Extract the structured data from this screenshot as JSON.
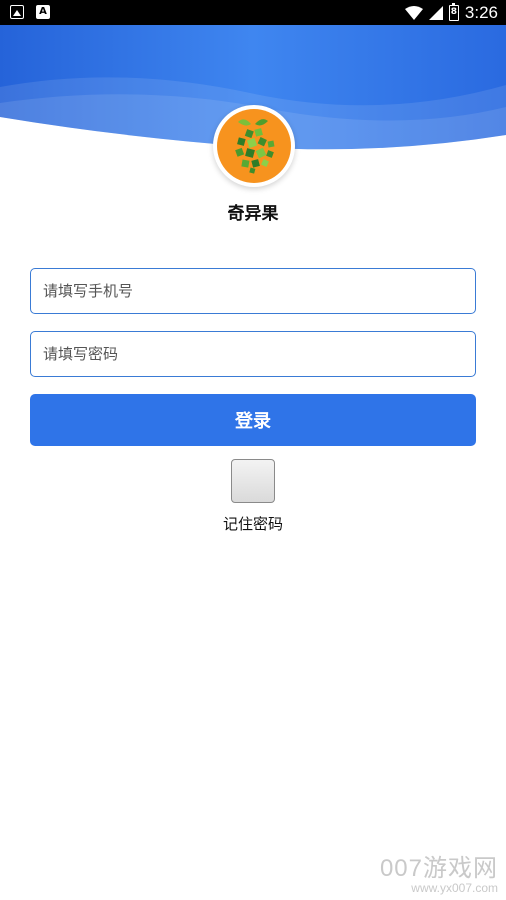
{
  "status_bar": {
    "time": "3:26",
    "battery_label": "8",
    "icons": [
      "image-icon",
      "a-icon",
      "wifi-icon",
      "signal-icon",
      "battery-icon"
    ]
  },
  "app": {
    "name": "奇异果"
  },
  "form": {
    "phone_placeholder": "请填写手机号",
    "password_placeholder": "请填写密码",
    "login_label": "登录",
    "remember_label": "记住密码",
    "remember_checked": false
  },
  "watermark": {
    "main": "007游戏网",
    "url": "www.yx007.com"
  },
  "colors": {
    "header_blue": "#2f74e8",
    "button_blue": "#2f74e8",
    "field_border": "#3a7bd5",
    "logo_orange": "#f7931e",
    "logo_green": "#3e8e2c"
  }
}
